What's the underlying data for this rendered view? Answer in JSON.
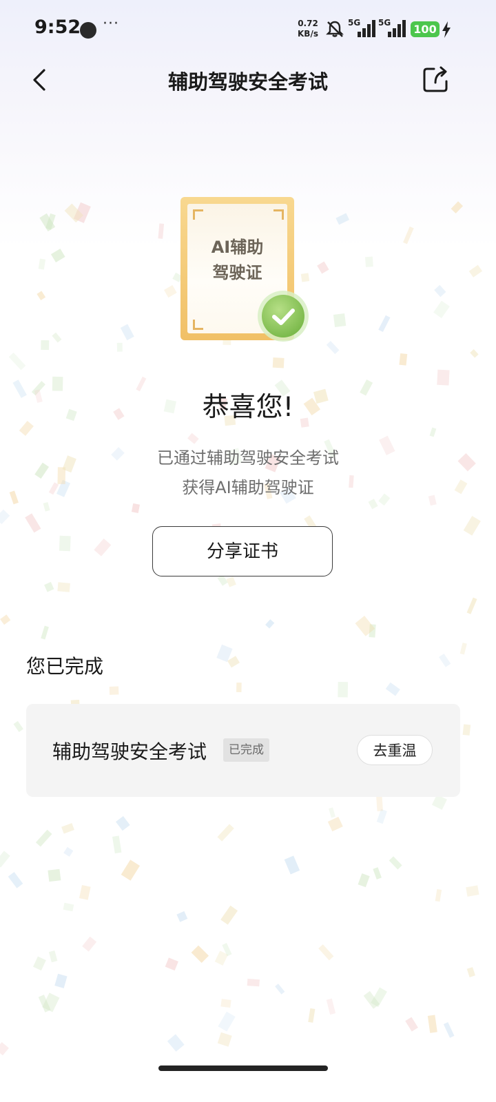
{
  "status_bar": {
    "time": "9:52",
    "more": "···",
    "speed_value": "0.72",
    "speed_unit": "KB/s",
    "net1": "5G",
    "net2": "5G",
    "battery": "100"
  },
  "nav": {
    "title": "辅助驾驶安全考试"
  },
  "certificate": {
    "line1": "AI辅助",
    "line2": "驾驶证"
  },
  "hero": {
    "congrats": "恭喜您!",
    "line1": "已通过辅助驾驶安全考试",
    "line2": "获得AI辅助驾驶证",
    "share_button": "分享证书"
  },
  "section_title": "您已完成",
  "completed_list": [
    {
      "name": "辅助驾驶安全考试",
      "status": "已完成",
      "action": "去重温"
    }
  ],
  "colors": {
    "accent_gold": "#f1c066",
    "check_green": "#8cc85a",
    "battery_green": "#4cc64d"
  }
}
